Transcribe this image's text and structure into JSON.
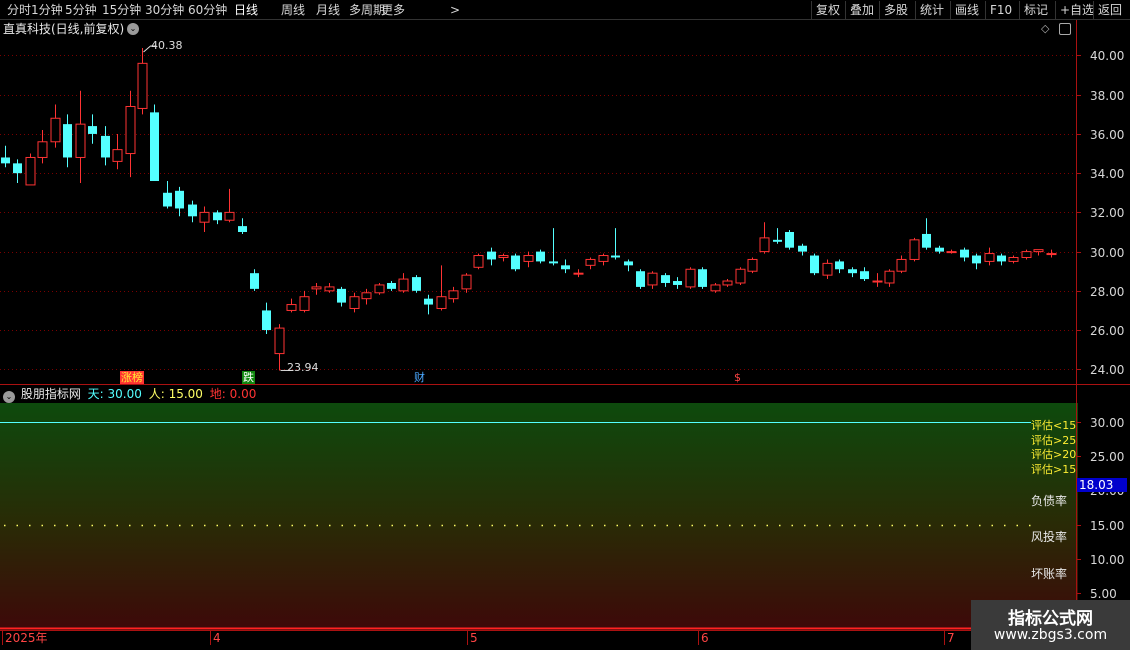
{
  "toolbar": {
    "periods": [
      "分时",
      "1分钟",
      "5分钟",
      "15分钟",
      "30分钟",
      "60分钟",
      "日线",
      "周线",
      "月线",
      "多周期",
      "更多"
    ],
    "active_period": "日线",
    "more_arrow": ">",
    "right_buttons": [
      "复权",
      "叠加",
      "多股",
      "统计",
      "画线",
      "F10",
      "标记",
      "+自选",
      "返回"
    ]
  },
  "stock": {
    "title": "直真科技(日线,前复权)",
    "high_label": "40.38",
    "low_label": "23.94"
  },
  "markers": {
    "zhangting": "涨榜",
    "die": "跌",
    "cai": "财",
    "dollar": "$"
  },
  "indicator": {
    "name": "股朋指标网",
    "tian_label": "天: 30.00",
    "ren_label": "人: 15.00",
    "di_label": "地: 0.00",
    "current_value": "18.03",
    "eval_labels": [
      "评估<15",
      "评估>25",
      "评估>20",
      "评估>15"
    ],
    "side_labels": [
      "负债率",
      "风投率",
      "坏账率"
    ]
  },
  "axes": {
    "price_ticks": [
      "40.00",
      "38.00",
      "36.00",
      "34.00",
      "32.00",
      "30.00",
      "28.00",
      "26.00",
      "24.00"
    ],
    "indicator_ticks": [
      "30.00",
      "25.00",
      "20.00",
      "15.00",
      "10.00",
      "5.00"
    ],
    "x_labels": [
      "2025年",
      "4",
      "5",
      "6",
      "7"
    ]
  },
  "colors": {
    "up": "#ff3333",
    "down": "#54ffff",
    "grid": "#8b0000",
    "tian_line": "#54ffff",
    "ren_line": "#ffff66",
    "di_line": "#ff3333",
    "bg_green": "#0a4a0a",
    "bg_red": "#3a0808"
  },
  "watermark": {
    "title": "指标公式网",
    "url": "www.zbgs3.com"
  },
  "chart_data": {
    "type": "candlestick",
    "title": "直真科技(日线,前复权)",
    "ylim": [
      23.3,
      41.3
    ],
    "x_labels": [
      "2025年",
      "4",
      "5",
      "6",
      "7"
    ],
    "candles": [
      {
        "o": 34.8,
        "c": 34.5,
        "h": 35.4,
        "l": 34.3
      },
      {
        "o": 34.5,
        "c": 34.0,
        "h": 34.7,
        "l": 33.5
      },
      {
        "o": 33.4,
        "c": 34.8,
        "h": 35.0,
        "l": 33.4
      },
      {
        "o": 34.8,
        "c": 35.6,
        "h": 36.2,
        "l": 34.5
      },
      {
        "o": 35.6,
        "c": 36.8,
        "h": 37.5,
        "l": 35.3
      },
      {
        "o": 36.5,
        "c": 34.8,
        "h": 37.0,
        "l": 34.3
      },
      {
        "o": 34.8,
        "c": 36.5,
        "h": 38.2,
        "l": 33.5
      },
      {
        "o": 36.4,
        "c": 36.0,
        "h": 37.0,
        "l": 35.5
      },
      {
        "o": 35.9,
        "c": 34.8,
        "h": 36.4,
        "l": 34.4
      },
      {
        "o": 34.6,
        "c": 35.2,
        "h": 36.0,
        "l": 34.2
      },
      {
        "o": 35.0,
        "c": 37.4,
        "h": 38.2,
        "l": 33.8
      },
      {
        "o": 37.3,
        "c": 39.6,
        "h": 40.38,
        "l": 37.0
      },
      {
        "o": 37.1,
        "c": 33.6,
        "h": 37.5,
        "l": 33.6
      },
      {
        "o": 33.0,
        "c": 32.3,
        "h": 33.6,
        "l": 32.2
      },
      {
        "o": 33.1,
        "c": 32.2,
        "h": 33.3,
        "l": 31.8
      },
      {
        "o": 32.4,
        "c": 31.8,
        "h": 32.6,
        "l": 31.5
      },
      {
        "o": 31.5,
        "c": 32.0,
        "h": 32.3,
        "l": 31.0
      },
      {
        "o": 32.0,
        "c": 31.6,
        "h": 32.1,
        "l": 31.4
      },
      {
        "o": 31.6,
        "c": 32.0,
        "h": 33.2,
        "l": 31.5
      },
      {
        "o": 31.3,
        "c": 31.0,
        "h": 31.7,
        "l": 30.9
      },
      {
        "o": 28.9,
        "c": 28.1,
        "h": 29.1,
        "l": 28.0
      },
      {
        "o": 27.0,
        "c": 26.0,
        "h": 27.4,
        "l": 25.8
      },
      {
        "o": 24.8,
        "c": 26.1,
        "h": 26.3,
        "l": 23.94
      },
      {
        "o": 27.0,
        "c": 27.3,
        "h": 27.6,
        "l": 26.9
      },
      {
        "o": 27.0,
        "c": 27.7,
        "h": 28.0,
        "l": 26.9
      },
      {
        "o": 28.1,
        "c": 28.2,
        "h": 28.4,
        "l": 27.8
      },
      {
        "o": 28.0,
        "c": 28.2,
        "h": 28.4,
        "l": 27.9
      },
      {
        "o": 28.1,
        "c": 27.4,
        "h": 28.2,
        "l": 27.2
      },
      {
        "o": 27.1,
        "c": 27.7,
        "h": 27.9,
        "l": 26.9
      },
      {
        "o": 27.6,
        "c": 27.9,
        "h": 28.1,
        "l": 27.3
      },
      {
        "o": 27.9,
        "c": 28.3,
        "h": 28.4,
        "l": 27.8
      },
      {
        "o": 28.4,
        "c": 28.1,
        "h": 28.5,
        "l": 28.0
      },
      {
        "o": 28.0,
        "c": 28.6,
        "h": 28.9,
        "l": 27.9
      },
      {
        "o": 28.7,
        "c": 28.0,
        "h": 28.8,
        "l": 27.9
      },
      {
        "o": 27.6,
        "c": 27.3,
        "h": 27.8,
        "l": 26.8
      },
      {
        "o": 27.1,
        "c": 27.7,
        "h": 29.3,
        "l": 27.0
      },
      {
        "o": 27.6,
        "c": 28.0,
        "h": 28.2,
        "l": 27.4
      },
      {
        "o": 28.1,
        "c": 28.8,
        "h": 28.9,
        "l": 27.9
      },
      {
        "o": 29.2,
        "c": 29.8,
        "h": 29.9,
        "l": 29.1
      },
      {
        "o": 30.0,
        "c": 29.6,
        "h": 30.2,
        "l": 29.3
      },
      {
        "o": 29.7,
        "c": 29.8,
        "h": 29.9,
        "l": 29.5
      },
      {
        "o": 29.8,
        "c": 29.1,
        "h": 29.9,
        "l": 29.0
      },
      {
        "o": 29.5,
        "c": 29.8,
        "h": 30.0,
        "l": 29.2
      },
      {
        "o": 30.0,
        "c": 29.5,
        "h": 30.1,
        "l": 29.4
      },
      {
        "o": 29.5,
        "c": 29.4,
        "h": 31.2,
        "l": 29.3
      },
      {
        "o": 29.3,
        "c": 29.1,
        "h": 29.6,
        "l": 28.9
      },
      {
        "o": 28.9,
        "c": 28.9,
        "h": 29.1,
        "l": 28.7
      },
      {
        "o": 29.3,
        "c": 29.6,
        "h": 29.7,
        "l": 29.1
      },
      {
        "o": 29.5,
        "c": 29.8,
        "h": 29.9,
        "l": 29.3
      },
      {
        "o": 29.8,
        "c": 29.7,
        "h": 31.2,
        "l": 29.6
      },
      {
        "o": 29.5,
        "c": 29.3,
        "h": 29.6,
        "l": 29.0
      },
      {
        "o": 29.0,
        "c": 28.2,
        "h": 29.1,
        "l": 28.1
      },
      {
        "o": 28.3,
        "c": 28.9,
        "h": 29.0,
        "l": 28.1
      },
      {
        "o": 28.8,
        "c": 28.4,
        "h": 28.9,
        "l": 28.2
      },
      {
        "o": 28.5,
        "c": 28.3,
        "h": 28.7,
        "l": 28.1
      },
      {
        "o": 28.2,
        "c": 29.1,
        "h": 29.2,
        "l": 28.1
      },
      {
        "o": 29.1,
        "c": 28.2,
        "h": 29.2,
        "l": 28.1
      },
      {
        "o": 28.0,
        "c": 28.3,
        "h": 28.4,
        "l": 27.9
      },
      {
        "o": 28.3,
        "c": 28.5,
        "h": 28.6,
        "l": 28.2
      },
      {
        "o": 28.4,
        "c": 29.1,
        "h": 29.2,
        "l": 28.3
      },
      {
        "o": 29.0,
        "c": 29.6,
        "h": 29.7,
        "l": 28.9
      },
      {
        "o": 30.0,
        "c": 30.7,
        "h": 31.5,
        "l": 29.9
      },
      {
        "o": 30.6,
        "c": 30.5,
        "h": 31.2,
        "l": 30.4
      },
      {
        "o": 31.0,
        "c": 30.2,
        "h": 31.1,
        "l": 30.1
      },
      {
        "o": 30.3,
        "c": 30.0,
        "h": 30.4,
        "l": 29.8
      },
      {
        "o": 29.8,
        "c": 28.9,
        "h": 29.9,
        "l": 28.8
      },
      {
        "o": 28.8,
        "c": 29.4,
        "h": 29.6,
        "l": 28.6
      },
      {
        "o": 29.5,
        "c": 29.1,
        "h": 29.6,
        "l": 28.9
      },
      {
        "o": 29.1,
        "c": 28.9,
        "h": 29.2,
        "l": 28.7
      },
      {
        "o": 29.0,
        "c": 28.6,
        "h": 29.2,
        "l": 28.5
      },
      {
        "o": 28.5,
        "c": 28.5,
        "h": 28.9,
        "l": 28.2
      },
      {
        "o": 28.4,
        "c": 29.0,
        "h": 29.1,
        "l": 28.2
      },
      {
        "o": 29.0,
        "c": 29.6,
        "h": 29.8,
        "l": 28.9
      },
      {
        "o": 29.6,
        "c": 30.6,
        "h": 30.7,
        "l": 29.5
      },
      {
        "o": 30.9,
        "c": 30.2,
        "h": 31.7,
        "l": 30.1
      },
      {
        "o": 30.2,
        "c": 30.0,
        "h": 30.3,
        "l": 29.9
      },
      {
        "o": 30.0,
        "c": 30.0,
        "h": 30.1,
        "l": 29.9
      },
      {
        "o": 30.1,
        "c": 29.7,
        "h": 30.2,
        "l": 29.5
      },
      {
        "o": 29.8,
        "c": 29.4,
        "h": 29.9,
        "l": 29.1
      },
      {
        "o": 29.5,
        "c": 29.9,
        "h": 30.2,
        "l": 29.3
      },
      {
        "o": 29.8,
        "c": 29.5,
        "h": 29.9,
        "l": 29.3
      },
      {
        "o": 29.5,
        "c": 29.7,
        "h": 29.8,
        "l": 29.4
      },
      {
        "o": 29.7,
        "c": 30.0,
        "h": 30.1,
        "l": 29.6
      },
      {
        "o": 30.0,
        "c": 30.1,
        "h": 30.1,
        "l": 29.8
      },
      {
        "o": 29.9,
        "c": 29.9,
        "h": 30.1,
        "l": 29.7
      }
    ],
    "indicator": {
      "name": "股朋指标网",
      "series": [
        {
          "name": "天",
          "value": 30.0
        },
        {
          "name": "人",
          "value": 15.0
        },
        {
          "name": "地",
          "value": 0.0
        }
      ],
      "ylim": [
        0,
        32.5
      ],
      "current_value": 18.03
    }
  }
}
